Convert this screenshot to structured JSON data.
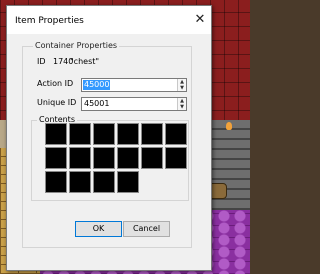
{
  "dialog": {
    "title": "Item Properties",
    "close_glyph": "✕"
  },
  "container": {
    "legend": "Container Properties",
    "id_label": "ID",
    "id_value": "1740",
    "name_value": "\"chest\""
  },
  "fields": {
    "action_label": "Action ID",
    "action_value": "45000",
    "unique_label": "Unique ID",
    "unique_value": "45001",
    "spin_up_glyph": "▲",
    "spin_down_glyph": "▼"
  },
  "contents": {
    "legend": "Contents",
    "slot_count": 16
  },
  "buttons": {
    "ok": "OK",
    "cancel": "Cancel"
  },
  "icons": {
    "close": "close-icon",
    "spin_up": "arrow-up-icon",
    "spin_down": "arrow-down-icon"
  }
}
